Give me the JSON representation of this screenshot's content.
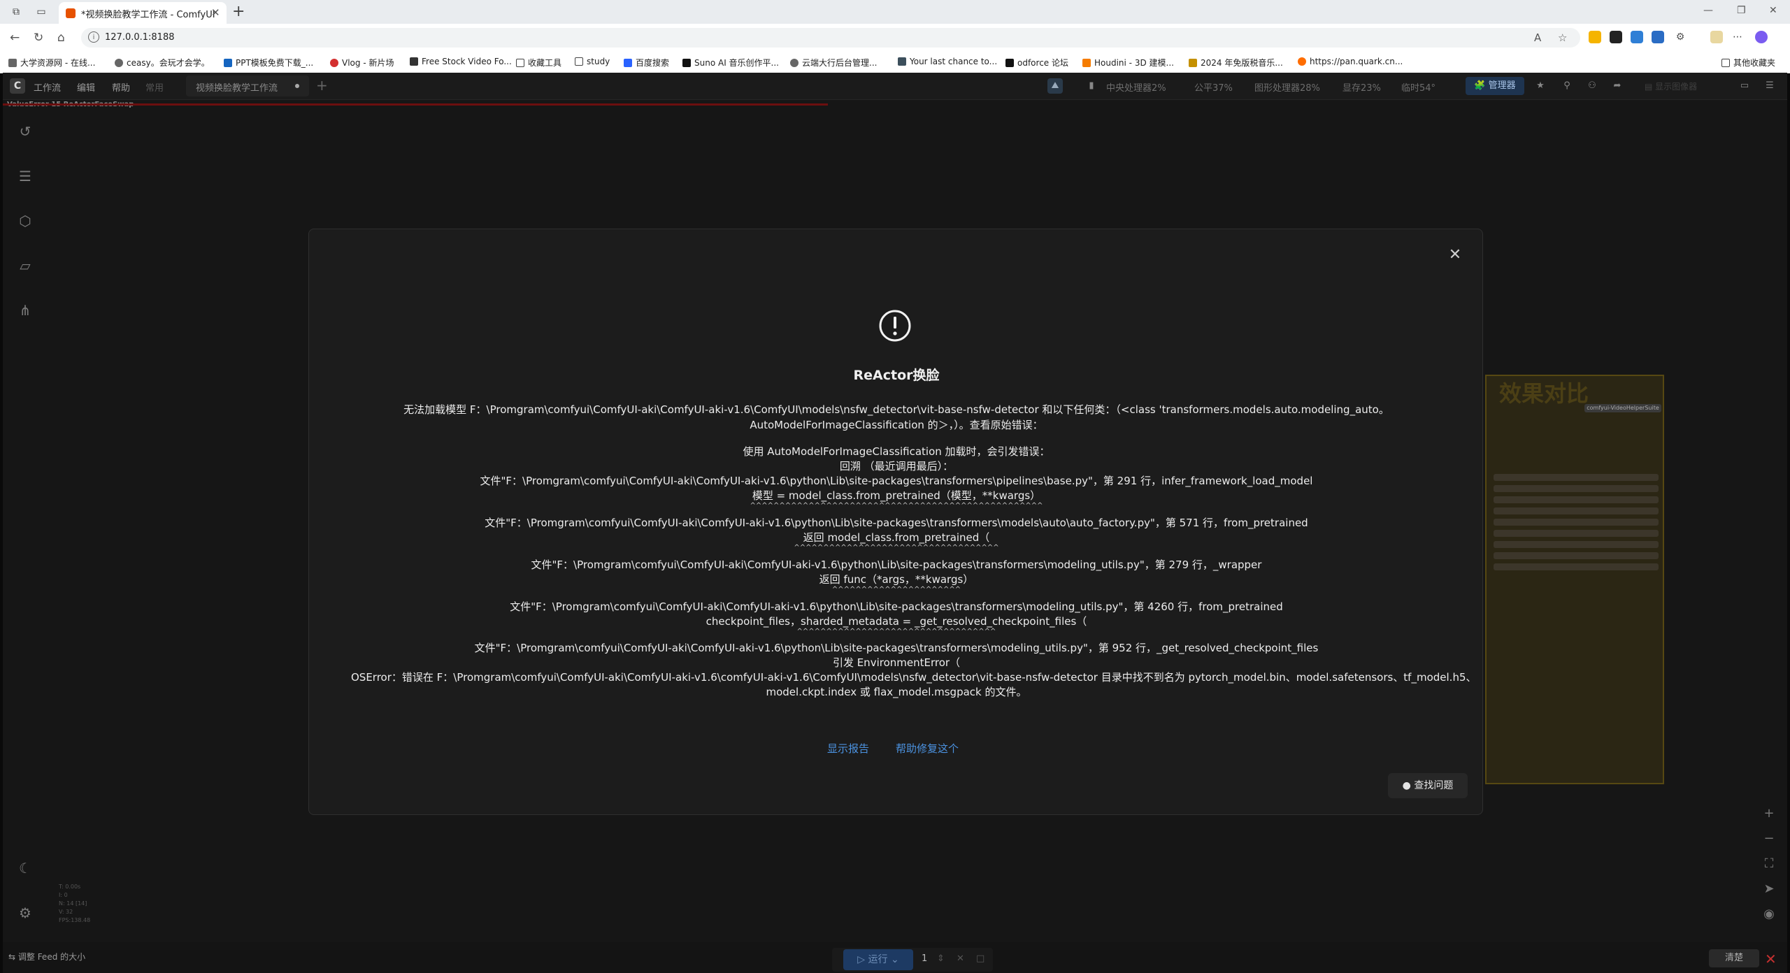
{
  "browser": {
    "tab_title": "*视频换脸教学工作流 - ComfyUI",
    "url": "127.0.0.1:8188",
    "bookmarks": [
      "大学资源网 - 在线...",
      "ceasy。会玩才会学。",
      "PPT模板免费下载_...",
      "Vlog - 新片场",
      "Free Stock Video Fo...",
      "收藏工具",
      "study",
      "百度搜索",
      "Suno AI 音乐创作平...",
      "云端大行后台管理...",
      "Your last chance to...",
      "odforce 论坛",
      "Houdini - 3D 建模...",
      "2024 年免版税音乐...",
      "https://pan.quark.cn...",
      "其他收藏夹"
    ]
  },
  "app": {
    "logo": "C",
    "menu": [
      "工作流",
      "编辑",
      "帮助",
      "常用"
    ],
    "workflow_tab": "视频换脸教学工作流",
    "stats": [
      "中央处理器2%",
      "公平37%",
      "图形处理器28%",
      "显存23%",
      "临时54°"
    ],
    "manager_label": "管理器",
    "display_image_label": "显示图像器",
    "error_banner": "ValueError 15 ReActorFaceSwap",
    "canvas_info": [
      "T: 0.00s",
      "I: 0",
      "N: 14 [14]",
      "V: 32",
      "FPS:138.48"
    ],
    "resize_feed": "调整 Feed 的大小",
    "run_label": "运行",
    "run_count": "1",
    "clear_label": "清楚",
    "bg_node_title": "效果对比",
    "bg_node_chip": "comfyui-VideoHelperSuite"
  },
  "modal": {
    "title": "ReActor换脸",
    "lines": [
      "无法加载模型 F：\\Promgram\\comfyui\\ComfyUI-aki\\ComfyUI-aki-v1.6\\ComfyUI\\models\\nsfw_detector\\vit-base-nsfw-detector 和以下任何类：（<class 'transformers.models.auto.modeling_auto。",
      "AutoModelForImageClassification 的＞，）。查看原始错误：",
      "使用 AutoModelForImageClassification 加载时，会引发错误：",
      "回溯 （最近调用最后）：",
      "文件\"F：\\Promgram\\comfyui\\ComfyUI-aki\\ComfyUI-aki-v1.6\\python\\Lib\\site-packages\\transformers\\pipelines\\base.py\"，第 291 行，infer_framework_load_model",
      "模型 = model_class.from_pretrained（模型，**kwargs）",
      "^^^^^^^^^^^^^^^^^^^^^^^^^^^^^^^^^^^^^^^^^^^^^^^^^^",
      "文件\"F：\\Promgram\\comfyui\\ComfyUI-aki\\ComfyUI-aki-v1.6\\python\\Lib\\site-packages\\transformers\\models\\auto\\auto_factory.py\"，第 571 行，from_pretrained",
      "返回 model_class.from_pretrained（",
      "^^^^^^^^^^^^^^^^^^^^^^^^^^^^^^^^^^^",
      "文件\"F：\\Promgram\\comfyui\\ComfyUI-aki\\ComfyUI-aki-v1.6\\python\\Lib\\site-packages\\transformers\\modeling_utils.py\"，第 279 行，_wrapper",
      "返回 func（*args，**kwargs）",
      "^^^^^^^^^^^^^^^^^^^^^^",
      "文件\"F：\\Promgram\\comfyui\\ComfyUI-aki\\ComfyUI-aki-v1.6\\python\\Lib\\site-packages\\transformers\\modeling_utils.py\"，第 4260 行，from_pretrained",
      "checkpoint_files，sharded_metadata = _get_resolved_checkpoint_files（",
      "^^^^^^^^^^^^^^^^^^^^^^^^^^^^^^^^^^",
      "文件\"F：\\Promgram\\comfyui\\ComfyUI-aki\\ComfyUI-aki-v1.6\\python\\Lib\\site-packages\\transformers\\modeling_utils.py\"，第 952 行，_get_resolved_checkpoint_files",
      "引发 EnvironmentError（",
      "OSError：错误在 F：\\Promgram\\comfyui\\ComfyUI-aki\\ComfyUI-aki-v1.6\\comfyUI-aki-v1.6\\ComfyUI\\models\\nsfw_detector\\vit-base-nsfw-detector 目录中找不到名为 pytorch_model.bin、model.safetensors、tf_model.h5、",
      "model.ckpt.index 或 flax_model.msgpack 的文件。"
    ],
    "show_report": "显示报告",
    "help_fix": "帮助修复这个",
    "find_issue": "查找问题"
  }
}
